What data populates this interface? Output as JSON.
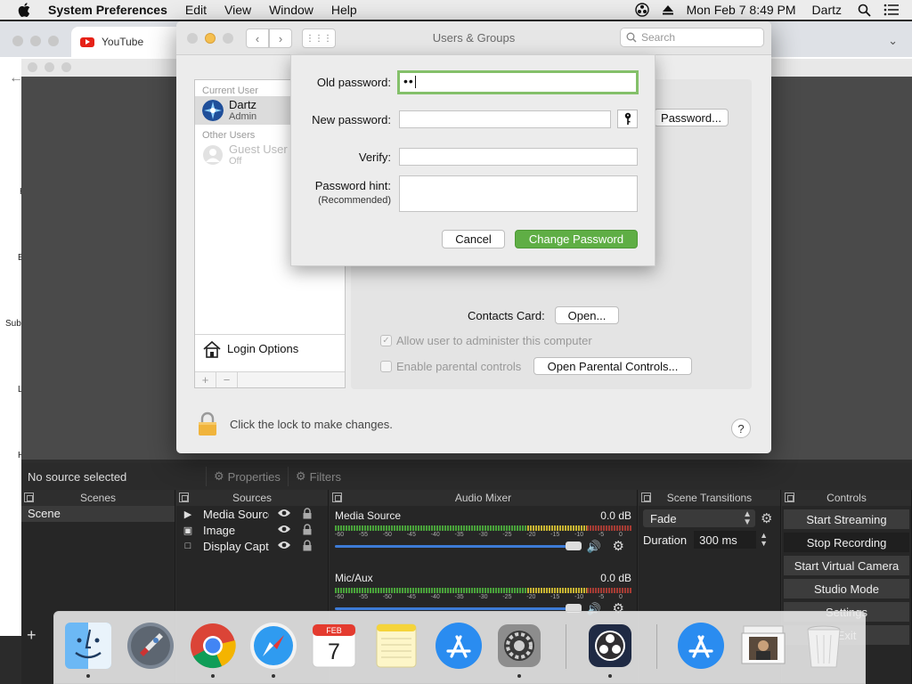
{
  "menubar": {
    "app_name": "System Preferences",
    "items": [
      "Edit",
      "View",
      "Window",
      "Help"
    ],
    "clock": "Mon Feb 7  8:49 PM",
    "user": "Dartz"
  },
  "browser": {
    "tab_title": "YouTube",
    "side_letters": [
      "H",
      "E",
      "Subs",
      "L",
      "H"
    ]
  },
  "prefs": {
    "title": "Users & Groups",
    "search_placeholder": "Search",
    "current_user_header": "Current User",
    "current_user": {
      "name": "Dartz",
      "role": "Admin"
    },
    "other_users_header": "Other Users",
    "guest_user": {
      "name": "Guest User",
      "status": "Off"
    },
    "login_options": "Login Options",
    "change_password_button": "Password...",
    "contacts_card_label": "Contacts Card:",
    "open_button": "Open...",
    "allow_admin_label": "Allow user to administer this computer",
    "parental_label": "Enable parental controls",
    "open_parental_button": "Open Parental Controls...",
    "lock_text": "Click the lock to make changes.",
    "help": "?"
  },
  "sheet": {
    "old_password_label": "Old password:",
    "old_password_value": "••",
    "new_password_label": "New password:",
    "verify_label": "Verify:",
    "hint_label": "Password hint:",
    "hint_sublabel": "(Recommended)",
    "cancel_label": "Cancel",
    "change_label": "Change Password"
  },
  "obs": {
    "no_source": "No source selected",
    "properties_label": "Properties",
    "filters_label": "Filters",
    "docks": {
      "scenes": "Scenes",
      "sources": "Sources",
      "mixer": "Audio Mixer",
      "transitions": "Scene Transitions",
      "controls": "Controls"
    },
    "scenes": [
      "Scene"
    ],
    "sources": [
      {
        "name": "Media Source",
        "icon": "play-icon"
      },
      {
        "name": "Image",
        "icon": "image-icon"
      },
      {
        "name": "Display Capture",
        "icon": "monitor-icon"
      }
    ],
    "mixer_channels": [
      {
        "name": "Media Source",
        "level": "0.0 dB"
      },
      {
        "name": "Mic/Aux",
        "level": "0.0 dB"
      }
    ],
    "meter_ticks": [
      "-60",
      "-55",
      "-50",
      "-45",
      "-40",
      "-35",
      "-30",
      "-25",
      "-20",
      "-15",
      "-10",
      "-5",
      "0"
    ],
    "transition": "Fade",
    "duration_label": "Duration",
    "duration_value": "300 ms",
    "controls": [
      "Start Streaming",
      "Stop Recording",
      "Start Virtual Camera",
      "Studio Mode",
      "Settings",
      "Exit"
    ]
  },
  "dock": {
    "apps": [
      "Finder",
      "Launchpad",
      "Chrome",
      "Safari",
      "Calendar",
      "Notes",
      "App Store",
      "System Preferences",
      "OBS",
      "App Store",
      "Downloads",
      "Trash"
    ],
    "calendar_month": "FEB",
    "calendar_day": "7"
  },
  "colors": {
    "accent_green": "#5fae45",
    "focus_ring": "#84c06a",
    "obs_slider": "#3d7bd6"
  }
}
